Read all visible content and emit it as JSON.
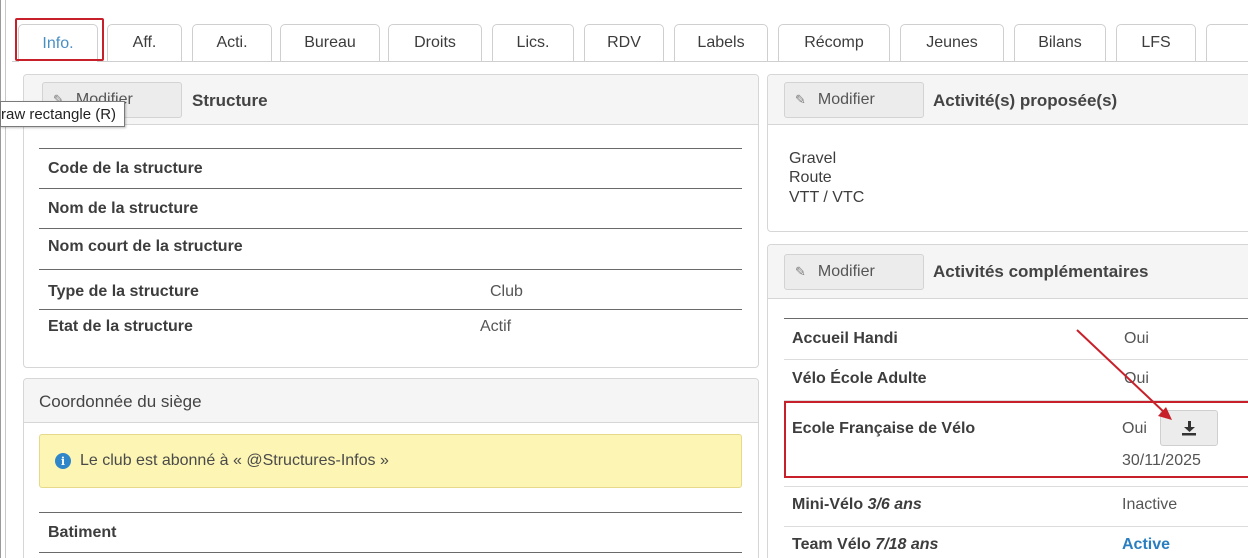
{
  "tabs": [
    {
      "label": "Info.",
      "active": true
    },
    {
      "label": "Aff.",
      "active": false
    },
    {
      "label": "Acti.",
      "active": false
    },
    {
      "label": "Bureau",
      "active": false
    },
    {
      "label": "Droits",
      "active": false
    },
    {
      "label": "Lics.",
      "active": false
    },
    {
      "label": "RDV",
      "active": false
    },
    {
      "label": "Labels",
      "active": false
    },
    {
      "label": "Récomp",
      "active": false
    },
    {
      "label": "Jeunes",
      "active": false
    },
    {
      "label": "Bilans",
      "active": false
    },
    {
      "label": "LFS",
      "active": false
    }
  ],
  "tooltip": "raw rectangle (R)",
  "structure": {
    "button_label": "Modifier",
    "title": "Structure",
    "rows": [
      {
        "label": "Code de la structure",
        "value": ""
      },
      {
        "label": "Nom de la structure",
        "value": ""
      },
      {
        "label": "Nom court de la structure",
        "value": ""
      },
      {
        "label": "Type de la structure",
        "value": "Club"
      },
      {
        "label": "Etat de la structure",
        "value": "Actif"
      }
    ]
  },
  "siege": {
    "title": "Coordonnée du siège",
    "notice": "Le club est abonné à « @Structures-Infos »",
    "row_label": "Batiment"
  },
  "activites_proposees": {
    "button_label": "Modifier",
    "title": "Activité(s) proposée(s)",
    "items": [
      "Gravel",
      "Route",
      "VTT / VTC"
    ]
  },
  "activites_complementaires": {
    "button_label": "Modifier",
    "title": "Activités complémentaires",
    "rows": [
      {
        "label": "Accueil Handi",
        "label_suffix": "",
        "value": "Oui"
      },
      {
        "label": "Vélo École Adulte",
        "label_suffix": "",
        "value": "Oui"
      },
      {
        "label": "Ecole Française de Vélo",
        "label_suffix": "",
        "value": "Oui",
        "date": "30/11/2025"
      },
      {
        "label": "Mini-Vélo",
        "label_suffix": "3/6 ans",
        "value": "Inactive"
      },
      {
        "label": "Team Vélo",
        "label_suffix": "7/18 ans",
        "value": "Active"
      }
    ]
  },
  "colors": {
    "highlight": "#c8202a",
    "active_tab": "#4a8fc4",
    "active_value": "#2a7ec0",
    "notice_bg": "#fcf5b4"
  },
  "icons": [
    "pencil-icon",
    "info-icon",
    "download-icon",
    "arrow-annotation"
  ]
}
